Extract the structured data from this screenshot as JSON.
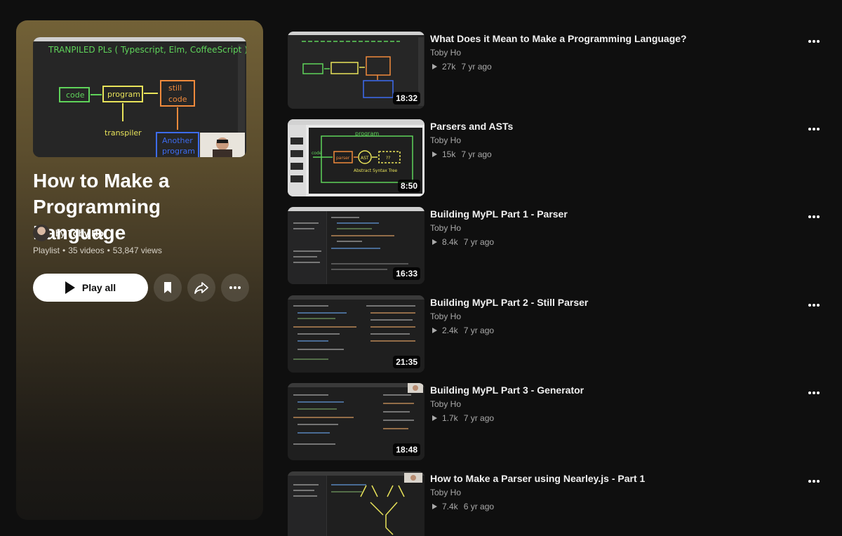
{
  "playlist": {
    "title": "How to Make a Programming Language",
    "owner_prefix": "by",
    "owner": "Toby Ho",
    "type": "Playlist",
    "video_count": "35 videos",
    "views": "53,847 views",
    "play_all_label": "Play all",
    "cover_text": {
      "heading": "TRANPILED PLs ( Typescript, Elm, CoffeeScript )",
      "box1": "code",
      "box2": "program",
      "box3_line1": "still",
      "box3_line2": "code",
      "arrow_label": "transpiler",
      "box4_line1": "Another",
      "box4_line2": "program"
    }
  },
  "videos": [
    {
      "title": "What Does it Mean to Make a Programming Language?",
      "channel": "Toby Ho",
      "views": "27k",
      "age": "7 yr ago",
      "duration": "18:32"
    },
    {
      "title": "Parsers and ASTs",
      "channel": "Toby Ho",
      "views": "15k",
      "age": "7 yr ago",
      "duration": "8:50",
      "thumb_text": {
        "program": "program",
        "code": "code",
        "parser": "parser",
        "ast": "AST",
        "q": "??",
        "caption": "Abstract Syntax Tree"
      }
    },
    {
      "title": "Building MyPL Part 1 - Parser",
      "channel": "Toby Ho",
      "views": "8.4k",
      "age": "7 yr ago",
      "duration": "16:33"
    },
    {
      "title": "Building MyPL Part 2 - Still Parser",
      "channel": "Toby Ho",
      "views": "2.4k",
      "age": "7 yr ago",
      "duration": "21:35"
    },
    {
      "title": "Building MyPL Part 3 - Generator",
      "channel": "Toby Ho",
      "views": "1.7k",
      "age": "7 yr ago",
      "duration": "18:48"
    },
    {
      "title": "How to Make a Parser using Nearley.js - Part 1",
      "channel": "Toby Ho",
      "views": "7.4k",
      "age": "6 yr ago",
      "duration": ""
    }
  ],
  "icons": {
    "play": "play-icon",
    "save": "bookmark-icon",
    "share": "share-icon",
    "more": "more-horizontal-icon"
  },
  "colors": {
    "background": "#0f0f0f",
    "panel_top": "#726137",
    "accent_green": "#5fd35a",
    "accent_yellow": "#e8e35a",
    "accent_orange": "#f08a3c",
    "accent_blue": "#3d6cf0"
  }
}
